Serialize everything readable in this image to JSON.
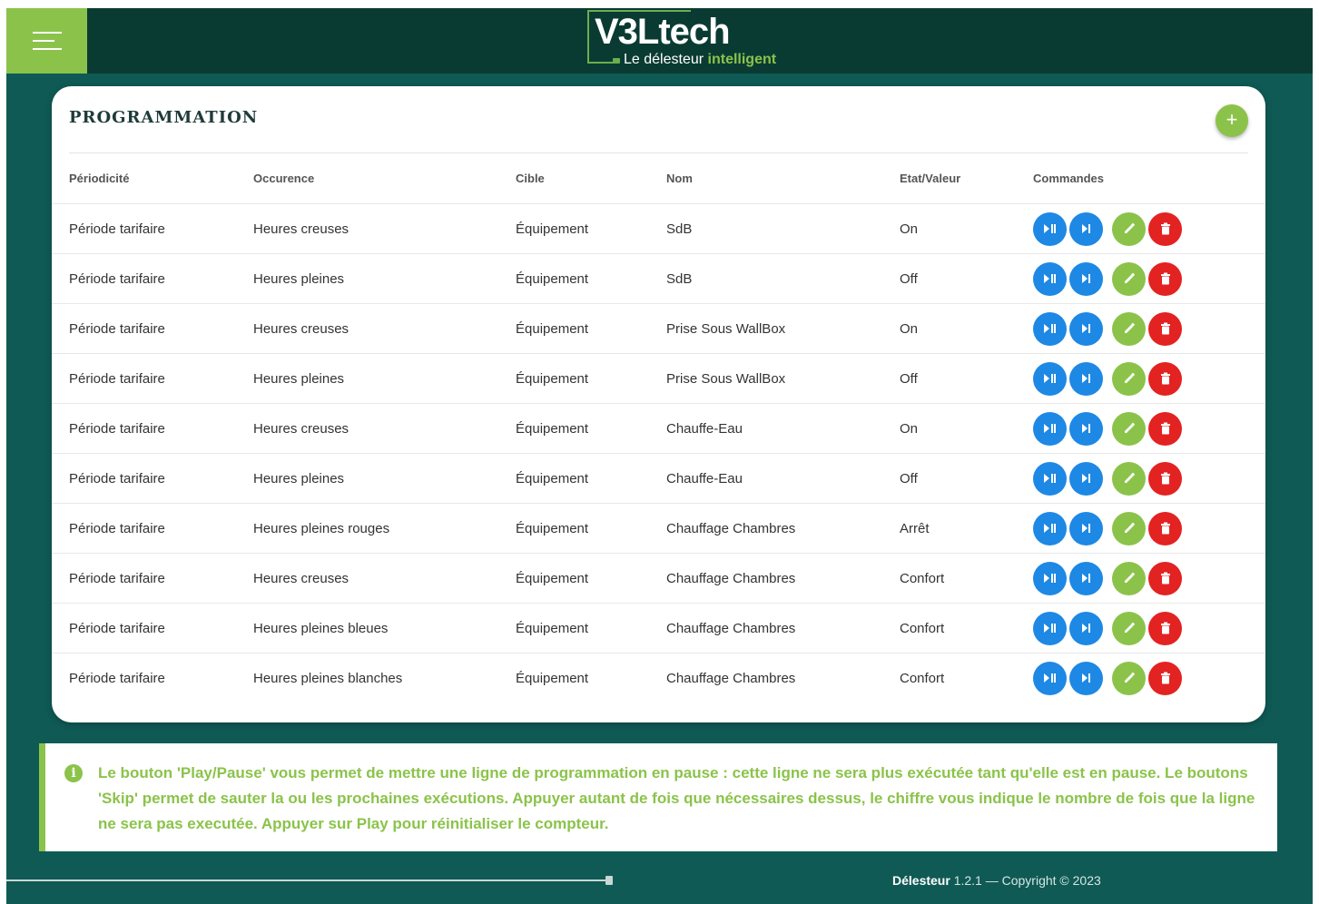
{
  "header": {
    "brand": "V3Ltech",
    "tagline_prefix": "Le délesteur ",
    "tagline_highlight": "intelligent"
  },
  "card": {
    "title": "PROGRAMMATION",
    "add_label": "+"
  },
  "table": {
    "headers": [
      "Périodicité",
      "Occurence",
      "Cible",
      "Nom",
      "Etat/Valeur",
      "Commandes"
    ],
    "rows": [
      [
        "Période tarifaire",
        "Heures creuses",
        "Équipement",
        "SdB",
        "On"
      ],
      [
        "Période tarifaire",
        "Heures pleines",
        "Équipement",
        "SdB",
        "Off"
      ],
      [
        "Période tarifaire",
        "Heures creuses",
        "Équipement",
        "Prise Sous WallBox",
        "On"
      ],
      [
        "Période tarifaire",
        "Heures pleines",
        "Équipement",
        "Prise Sous WallBox",
        "Off"
      ],
      [
        "Période tarifaire",
        "Heures creuses",
        "Équipement",
        "Chauffe-Eau",
        "On"
      ],
      [
        "Période tarifaire",
        "Heures pleines",
        "Équipement",
        "Chauffe-Eau",
        "Off"
      ],
      [
        "Période tarifaire",
        "Heures pleines rouges",
        "Équipement",
        "Chauffage Chambres",
        "Arrêt"
      ],
      [
        "Période tarifaire",
        "Heures creuses",
        "Équipement",
        "Chauffage Chambres",
        "Confort"
      ],
      [
        "Période tarifaire",
        "Heures pleines bleues",
        "Équipement",
        "Chauffage Chambres",
        "Confort"
      ],
      [
        "Période tarifaire",
        "Heures pleines blanches",
        "Équipement",
        "Chauffage Chambres",
        "Confort"
      ]
    ],
    "command_icons": [
      "play-pause-icon",
      "skip-icon",
      "edit-icon",
      "delete-icon"
    ]
  },
  "info": {
    "icon": "i",
    "text": "Le bouton 'Play/Pause' vous permet de mettre une ligne de programmation en pause : cette ligne ne sera plus exécutée tant qu'elle est en pause. Le boutons 'Skip' permet de sauter la ou les prochaines exécutions. Appuyer autant de fois que nécessaires dessus, le chiffre vous indique le nombre de fois que la ligne ne sera pas executée. Appuyer sur Play pour réinitialiser le compteur."
  },
  "footer": {
    "app": "Délesteur",
    "rest": " 1.2.1 — Copyright © 2023"
  },
  "colors": {
    "topbar": "#0a3b33",
    "background": "#0f5a55",
    "accent_green": "#8bc34a",
    "blue": "#1e88e5",
    "red": "#e32222"
  }
}
